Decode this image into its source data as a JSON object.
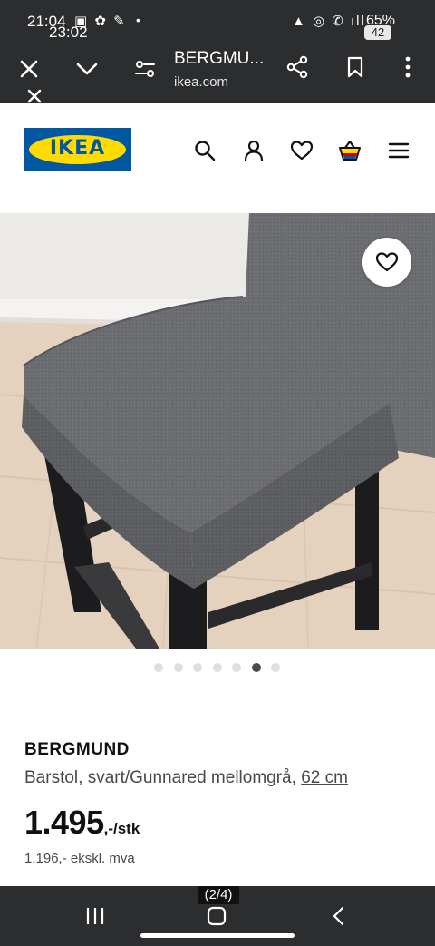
{
  "status_bar": {
    "time_primary": "21:04",
    "time_overlay": "23:02",
    "notification_icons": "▣ ✿ ✎",
    "dot": "•",
    "system_icons": "▲ ◎ ✆ ıll",
    "battery": "65%",
    "badge": "42"
  },
  "browser": {
    "title": "BERGMU...",
    "url": "ikea.com"
  },
  "header": {
    "logo_text": "IKEA"
  },
  "carousel": {
    "count": 7,
    "active_index": 5,
    "page_indicator": "(2/4)"
  },
  "product": {
    "name": "BERGMUND",
    "description": "Barstol, svart/Gunnared mellomgrå, ",
    "size_link": "62 cm",
    "price_amount": "1.495",
    "price_suffix": ",-/stk",
    "price_excl_vat": "1.196,- ekskl. mva"
  },
  "colors": {
    "ikea_blue": "#0058a3",
    "ikea_yellow": "#ffdb00",
    "chrome_dark": "#2b2d2f"
  }
}
